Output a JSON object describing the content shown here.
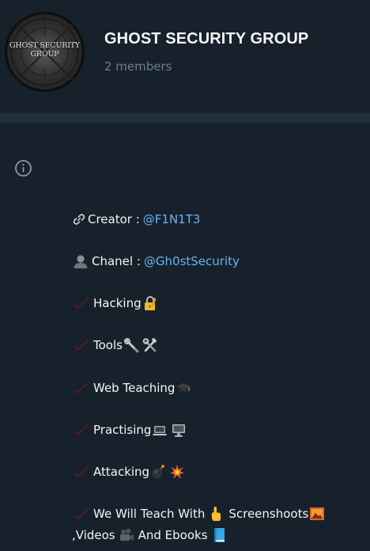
{
  "group": {
    "title": "GHOST SECURITY GROUP",
    "members": "2 members",
    "avatar_text_line1": "GHOST SECURITY",
    "avatar_text_line2": "GROUP"
  },
  "description": {
    "creator_label": "Creator :",
    "creator_handle": "@F1N1T3",
    "channel_label": "Chanel :",
    "channel_handle": "@Gh0stSecurity",
    "items": [
      {
        "label": "Hacking",
        "icon": "lock-key-icon"
      },
      {
        "label": "Tools",
        "icon": "wrench-icon"
      },
      {
        "label": "Web Teaching",
        "icon": "graduation-cap-icon"
      },
      {
        "label": "Practising",
        "icon": "laptop-icon"
      },
      {
        "label": "Attacking",
        "icon": "bomb-icon"
      }
    ],
    "teach_line1_prefix": "We Will Teach With",
    "teach_line1_suffix": "Screenshoots",
    "teach_line2_prefix": ",Videos",
    "teach_line2_suffix": "And Ebooks"
  },
  "colors": {
    "background": "#17212b",
    "divider": "#232e3c",
    "link": "#6ab2f2",
    "muted": "#6d7f8f",
    "check": "#b7204a"
  }
}
